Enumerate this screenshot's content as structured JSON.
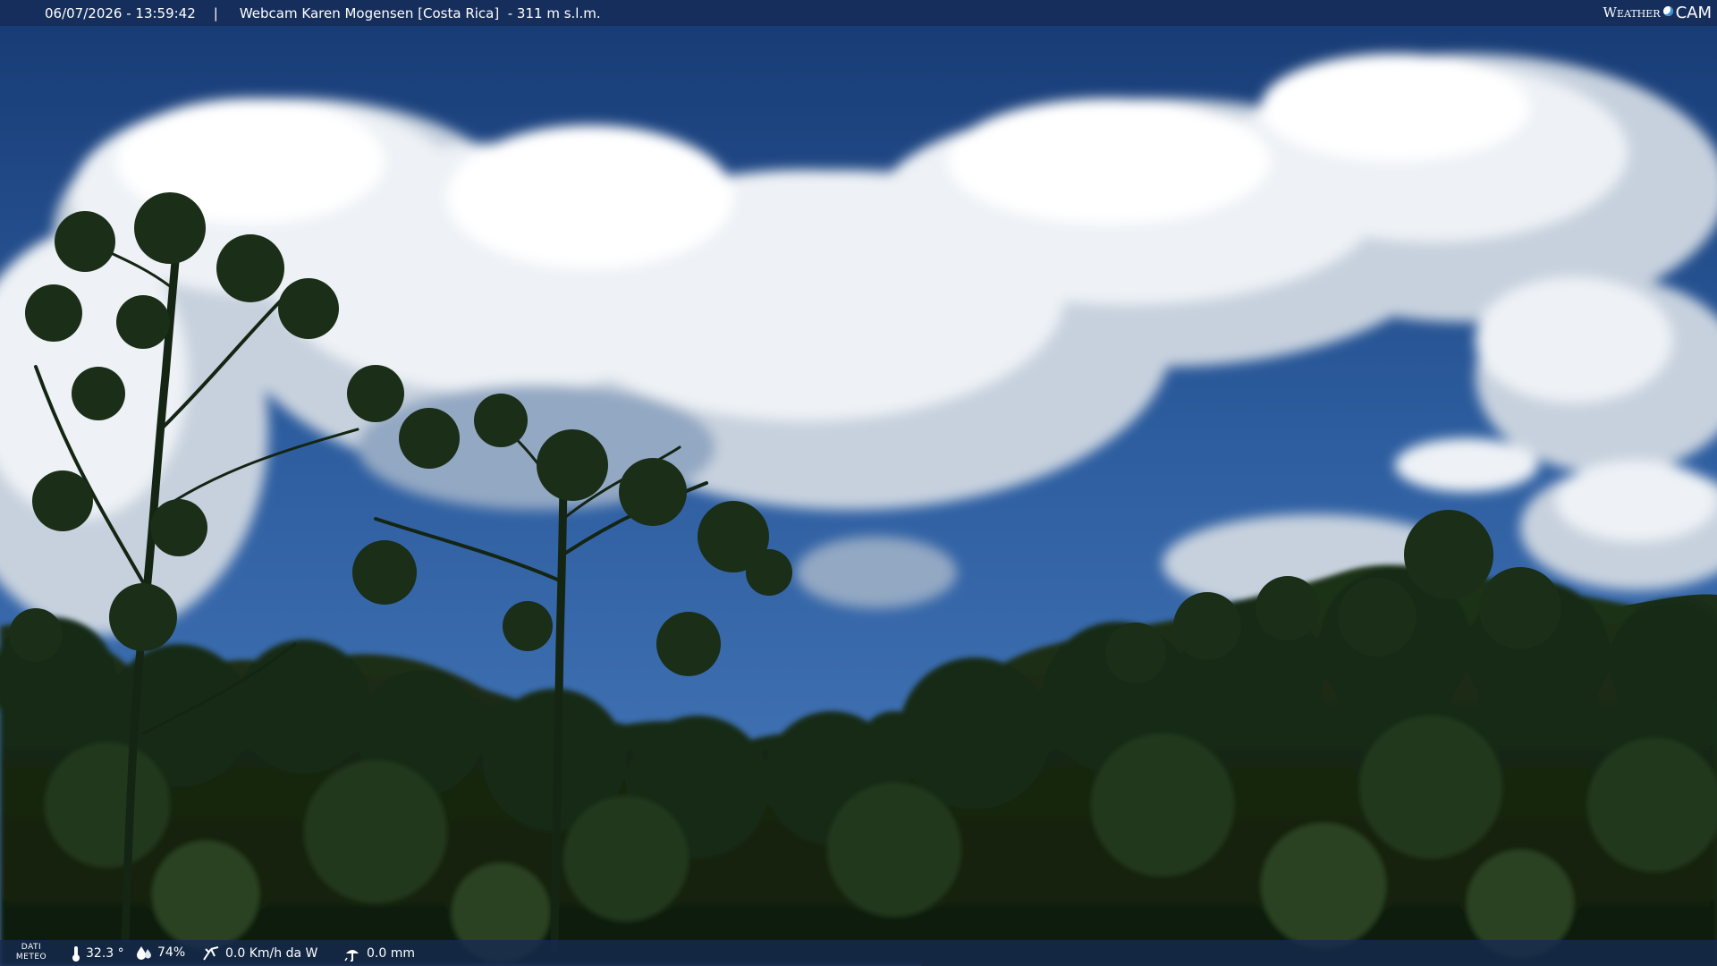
{
  "overlay": {
    "timestamp": "06/07/2026 - 13:59:42",
    "separator": "|",
    "title": "Webcam Karen Mogensen [Costa Rica]  - 311 m s.l.m.",
    "brand_weather": "Weather",
    "brand_cam": "CAM"
  },
  "meteo": {
    "label_line1": "DATI",
    "label_line2": "METEO",
    "temperature": "32.3 °",
    "humidity": "74%",
    "wind": "0.0 Km/h da W",
    "rain": "0.0 mm",
    "icons": [
      "thermometer-icon",
      "humidity-drop-icon",
      "wind-icon",
      "rain-gauge-icon"
    ]
  },
  "colors": {
    "sky": "#2c5c9c",
    "cloud": "#e8edf3",
    "forest": "#14260f",
    "bar": "#162a52"
  }
}
